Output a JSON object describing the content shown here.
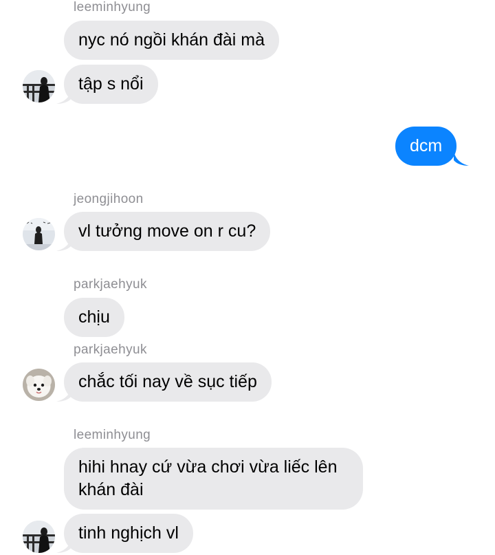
{
  "chat": {
    "messages": [
      {
        "sender": "leeminhyung",
        "text": "nyc nó ngồi khán đài mà"
      },
      {
        "text": "tập s nổi"
      },
      {
        "text": "dcm",
        "outgoing": true
      },
      {
        "sender": "jeongjihoon",
        "text": "vl tưởng move on r cu?"
      },
      {
        "sender": "parkjaehyuk",
        "text": "chịu"
      },
      {
        "sender": "parkjaehyuk",
        "text": "chắc tối nay về sục tiếp"
      },
      {
        "sender": "leeminhyung",
        "text": "hihi hnay cứ vừa chơi vừa liếc lên khán đài"
      },
      {
        "text": "tinh nghịch vl"
      }
    ]
  },
  "colors": {
    "incoming_bubble": "#e9e9eb",
    "outgoing_bubble": "#0b84ff",
    "sender_name": "#8e8e93"
  },
  "icons": {
    "leeminhyung_avatar": "person-on-railing-photo",
    "jeongjihoon_avatar": "person-standing-photo",
    "parkjaehyuk_avatar": "white-dog-photo"
  }
}
